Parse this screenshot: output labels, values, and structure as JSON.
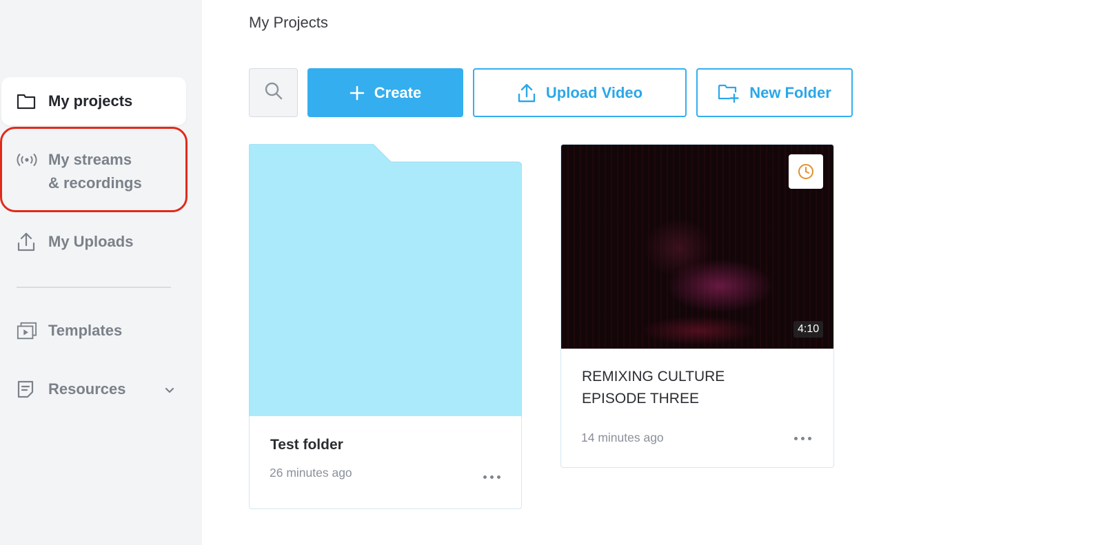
{
  "sidebar": {
    "items": [
      {
        "label": "My projects",
        "icon": "folder-icon",
        "active": true
      },
      {
        "label_line1": "My streams",
        "label_line2": "& recordings",
        "icon": "broadcast-icon",
        "highlighted": true
      },
      {
        "label": "My Uploads",
        "icon": "upload-icon"
      },
      {
        "label": "Templates",
        "icon": "templates-icon"
      },
      {
        "label": "Resources",
        "icon": "document-icon",
        "expandable": true
      }
    ],
    "highlight_color": "#e02a1a"
  },
  "header": {
    "title": "My Projects"
  },
  "toolbar": {
    "search_icon": "search-icon",
    "create_label": "Create",
    "upload_label": "Upload Video",
    "new_folder_label": "New Folder",
    "accent": "#34aeee"
  },
  "items": [
    {
      "type": "folder",
      "name": "Test folder",
      "time": "26 minutes ago",
      "color": "#abeafb"
    },
    {
      "type": "video",
      "title_line1": "REMIXING CULTURE",
      "title_line2": "EPISODE THREE",
      "time": "14 minutes ago",
      "duration": "4:10",
      "badge_icon": "clock-icon"
    }
  ]
}
